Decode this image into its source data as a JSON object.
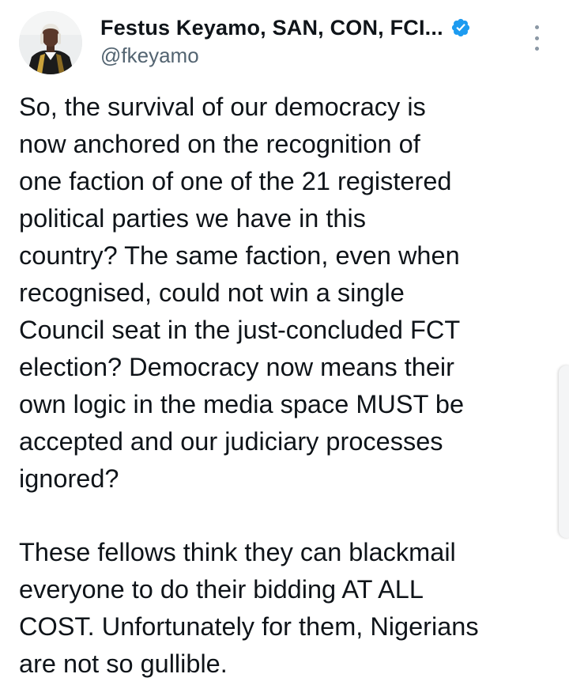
{
  "tweet": {
    "author": {
      "display_name": "Festus Keyamo, SAN, CON, FCI...",
      "handle": "@fkeyamo",
      "verified_icon": "verified-badge-icon",
      "avatar_icon": "avatar"
    },
    "menu_icon": "more-options-icon",
    "paragraphs": [
      [
        "So, the survival of our democracy is",
        "now anchored on the recognition of",
        "one faction of one of the 21 registered",
        "political parties we have in this",
        "country? The same faction, even when",
        "recognised, could not win a single",
        "Council seat in the just-concluded FCT",
        "election? Democracy now means their",
        "own logic in the media space MUST be",
        "accepted and our judiciary processes",
        "ignored?"
      ],
      [
        "These fellows think they can blackmail",
        "everyone to do their bidding AT ALL",
        "COST. Unfortunately for them, Nigerians",
        "are not so gullible."
      ]
    ]
  },
  "colors": {
    "text": "#0f1419",
    "secondary": "#536471",
    "verified_blue": "#1d9bf0",
    "background": "#ffffff"
  }
}
